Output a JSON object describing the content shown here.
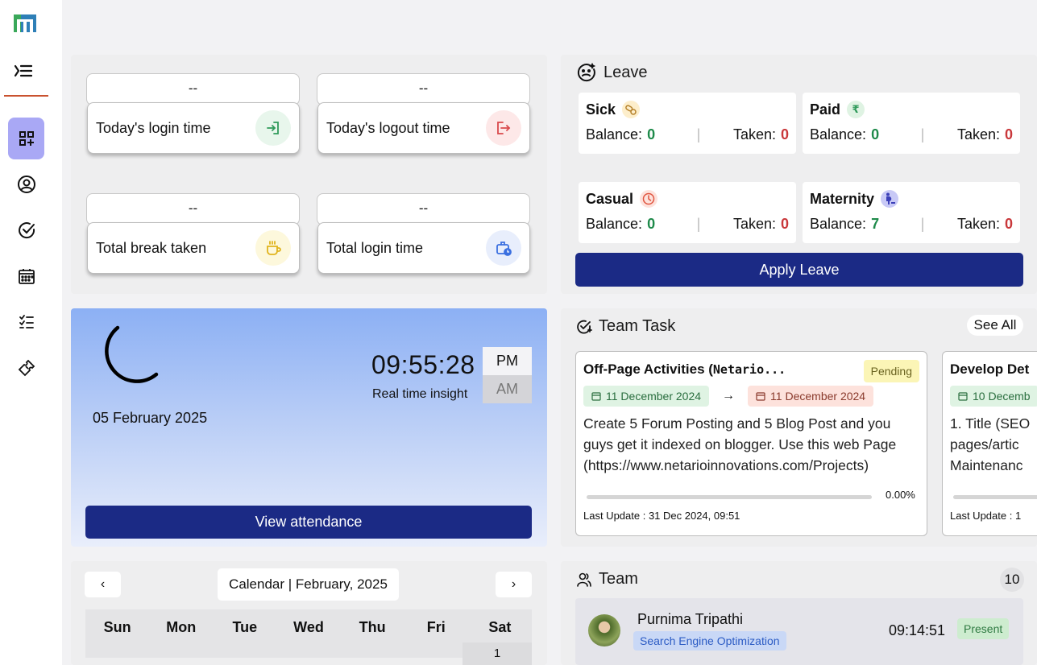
{
  "sidebar": {
    "items": [
      {
        "name": "dashboard",
        "icon": "grid-add-icon",
        "active": true
      },
      {
        "name": "profile",
        "icon": "user-circle-icon"
      },
      {
        "name": "tasks",
        "icon": "check-circle-icon"
      },
      {
        "name": "calendar",
        "icon": "calendar-icon"
      },
      {
        "name": "checklist",
        "icon": "checklist-icon"
      },
      {
        "name": "tickets",
        "icon": "ticket-icon"
      }
    ]
  },
  "attendance_cards": [
    {
      "value": "--",
      "label": "Today's login time",
      "icon": "login-icon",
      "color": "#2f9a5a",
      "bg": "#e8f6ec"
    },
    {
      "value": "--",
      "label": "Today's logout time",
      "icon": "logout-icon",
      "color": "#d9484b",
      "bg": "#fde8e8"
    },
    {
      "value": "--",
      "label": "Total break taken",
      "icon": "coffee-icon",
      "color": "#e0b31c",
      "bg": "#fdf8dc"
    },
    {
      "value": "--",
      "label": "Total login time",
      "icon": "briefcase-clock-icon",
      "color": "#3a6fe0",
      "bg": "#e8eefc"
    }
  ],
  "clock": {
    "date": "05 February 2025",
    "time": "09:55:28",
    "caption": "Real time insight",
    "pm": "PM",
    "am": "AM",
    "view_attendance": "View attendance"
  },
  "leave": {
    "title": "Leave",
    "balance_label": "Balance:",
    "taken_label": "Taken:",
    "sep": "|",
    "types": [
      {
        "name": "Sick",
        "balance": "0",
        "taken": "0",
        "icon": "pills-icon"
      },
      {
        "name": "Paid",
        "balance": "0",
        "taken": "0",
        "icon": "rupee-icon"
      },
      {
        "name": "Casual",
        "balance": "0",
        "taken": "0",
        "icon": "clock-icon"
      },
      {
        "name": "Maternity",
        "balance": "7",
        "taken": "0",
        "icon": "pregnant-icon"
      }
    ],
    "apply_label": "Apply Leave"
  },
  "team_task": {
    "title": "Team Task",
    "see_all": "See All",
    "tasks": [
      {
        "title_plain": "Off-Page Activities (",
        "title_mono": "Netario...",
        "status": "Pending",
        "start": "11 December 2024",
        "arrow": "→",
        "end": "11 December 2024",
        "desc": "Create 5 Forum Posting and 5 Blog Post and you guys get it indexed on blogger. Use this web Page (https://www.netarioinnovations.com/Projects)",
        "progress": "0.00%",
        "updated": "Last Update : 31 Dec 2024, 09:51"
      },
      {
        "title_plain": "Develop Det",
        "start": "10 Decemb",
        "desc": "1. Title (SEO pages/artic Maintenanc",
        "updated": "Last Update : 1"
      }
    ]
  },
  "calendar": {
    "prev": "‹",
    "next": "›",
    "title": "Calendar | February, 2025",
    "weekdays": [
      "Sun",
      "Mon",
      "Tue",
      "Wed",
      "Thu",
      "Fri",
      "Sat"
    ],
    "first_day": "1"
  },
  "team": {
    "title": "Team",
    "count": "10",
    "members": [
      {
        "name": "Purnima Tripathi",
        "dept": "Search Engine Optimization",
        "time": "09:14:51",
        "status": "Present"
      }
    ]
  }
}
